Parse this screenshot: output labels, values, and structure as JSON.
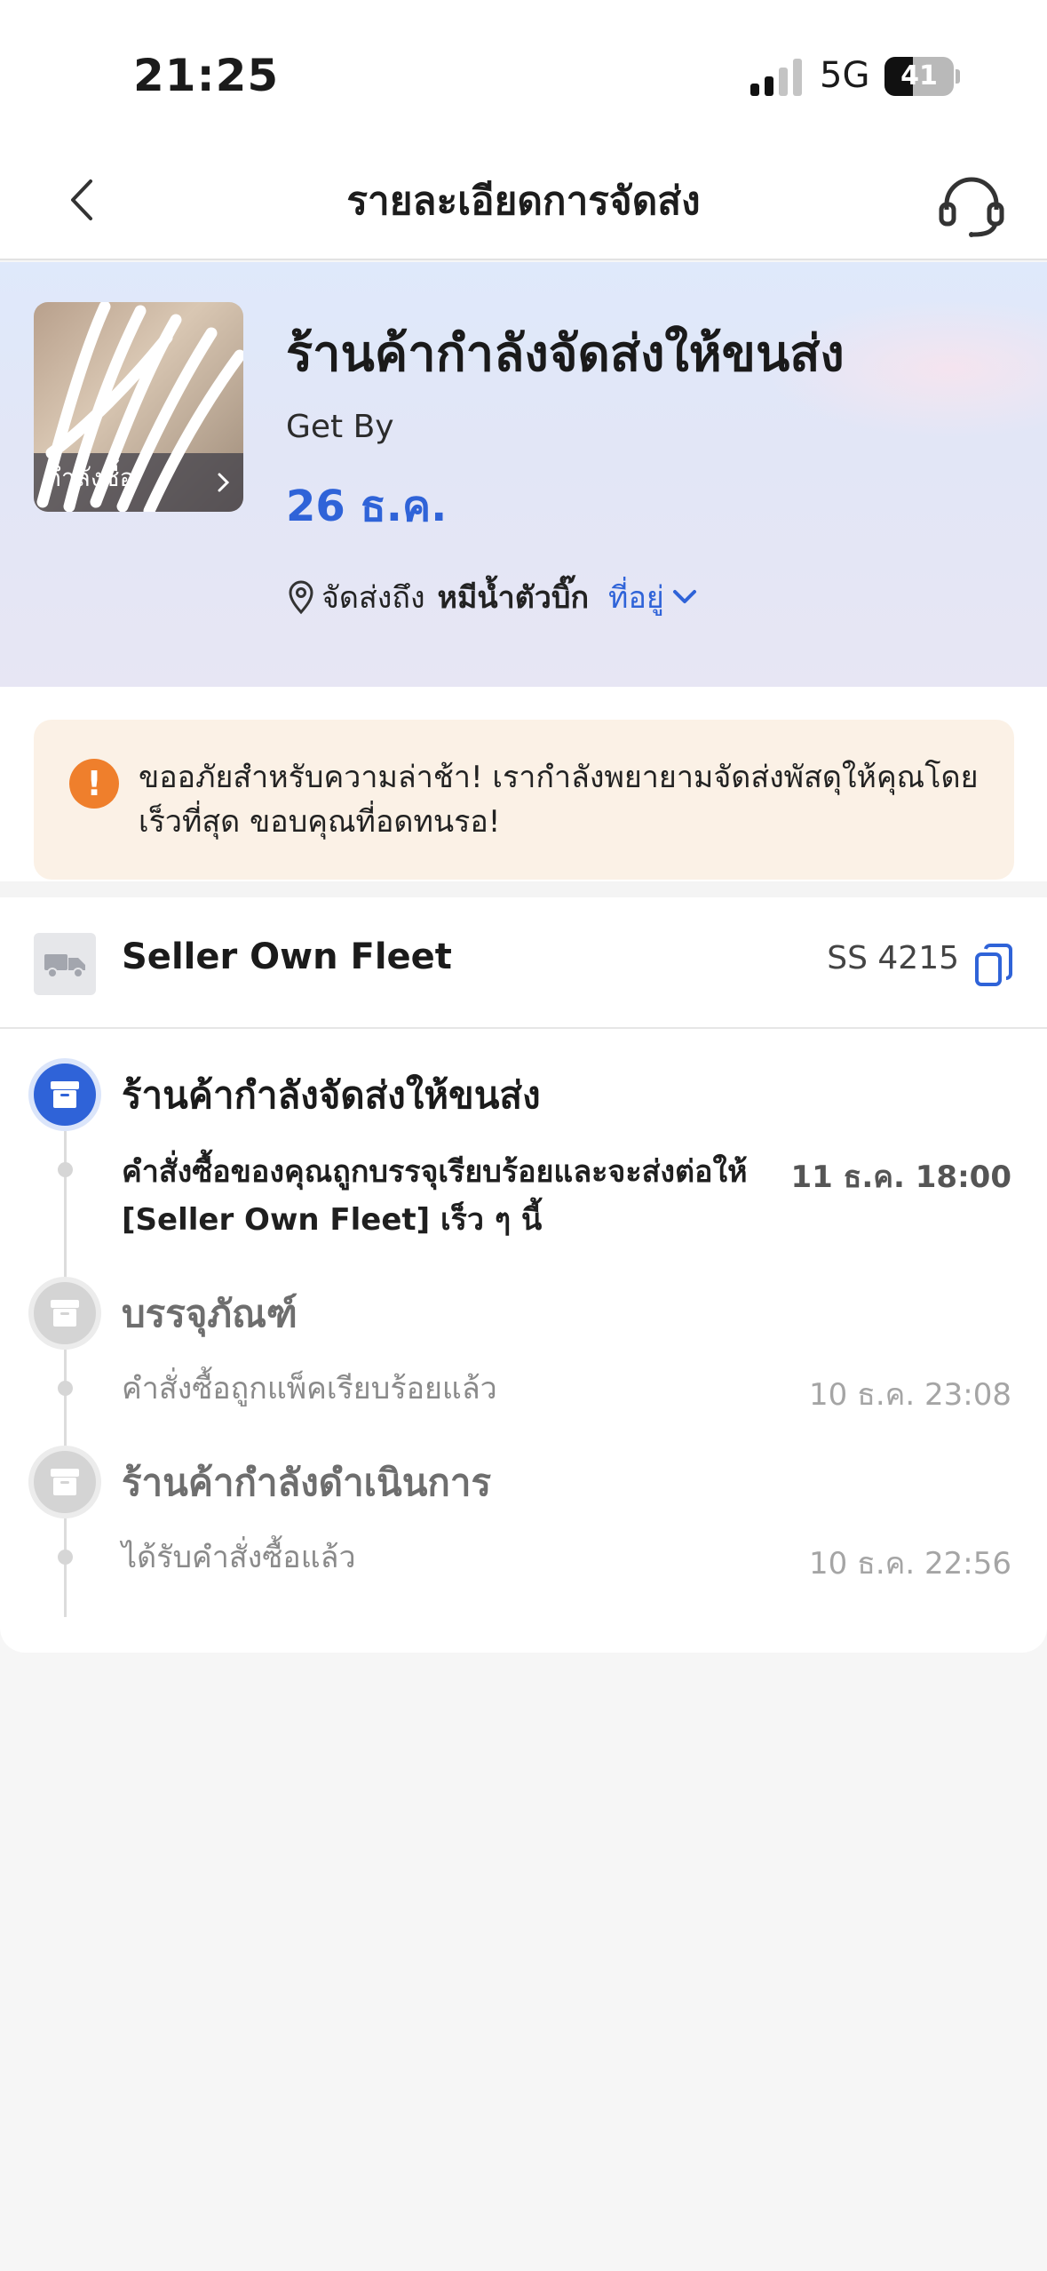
{
  "status_bar": {
    "time": "21:25",
    "network": "5G",
    "battery": "41",
    "battery_level_percent": 41
  },
  "nav": {
    "title": "รายละเอียดการจัดส่ง"
  },
  "hero": {
    "thumb_label": "กำลังซื้อ",
    "title": "ร้านค้ากำลังจัดส่งให้ขนส่ง",
    "get_by_label": "Get By",
    "date": "26 ธ.ค.",
    "addr_prefix": "จัดส่งถึง",
    "addr_name": "หมีน้ำตัวบิ๊ก",
    "addr_link": "ที่อยู่"
  },
  "notice": {
    "text": "ขออภัยสำหรับความล่าช้า! เรากำลังพยายามจัดส่งพัสดุให้คุณโดยเร็วที่สุด ขอบคุณที่อดทนรอ!"
  },
  "shipment": {
    "carrier": "Seller Own Fleet",
    "tracking_visible": "SS 4215"
  },
  "timeline": [
    {
      "title": "ร้านค้ากำลังจัดส่งให้ขนส่ง",
      "detail": "คำสั่งซื้อของคุณถูกบรรจุเรียบร้อยและจะส่งต่อให้ [Seller Own Fleet] เร็ว ๆ นี้",
      "time": "11 ธ.ค. 18:00",
      "active": true
    },
    {
      "title": "บรรจุภัณฑ์",
      "detail": "คำสั่งซื้อถูกแพ็คเรียบร้อยแล้ว",
      "time": "10 ธ.ค. 23:08",
      "active": false
    },
    {
      "title": "ร้านค้ากำลังดำเนินการ",
      "detail": "ได้รับคำสั่งซื้อแล้ว",
      "time": "10 ธ.ค. 22:56",
      "active": false
    }
  ],
  "colors": {
    "accent": "#2f63d8",
    "warning": "#ef7f2c",
    "notice_bg": "#fbf1e6"
  }
}
